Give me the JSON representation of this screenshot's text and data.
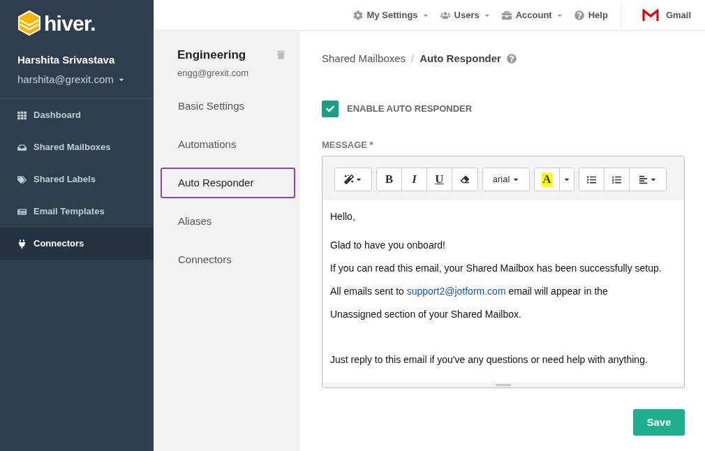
{
  "brand": {
    "name": "hiver."
  },
  "user": {
    "name": "Harshita Srivastava",
    "email": "harshita@grexit.com"
  },
  "nav": [
    {
      "label": "Dashboard",
      "selected": false
    },
    {
      "label": "Shared Mailboxes",
      "selected": false
    },
    {
      "label": "Shared Labels",
      "selected": false
    },
    {
      "label": "Email Templates",
      "selected": false
    },
    {
      "label": "Connectors",
      "selected": true
    }
  ],
  "topbar": [
    {
      "label": "My Settings",
      "dropdown": true
    },
    {
      "label": "Users",
      "dropdown": true
    },
    {
      "label": "Account",
      "dropdown": true
    },
    {
      "label": "Help",
      "dropdown": false
    }
  ],
  "gmail": {
    "label": "Gmail"
  },
  "mailbox": {
    "name": "Engineering",
    "email": "engg@grexit.com"
  },
  "settings_menu": [
    {
      "label": "Basic Settings",
      "selected": false
    },
    {
      "label": "Automations",
      "selected": false
    },
    {
      "label": "Auto Responder",
      "selected": true
    },
    {
      "label": "Aliases",
      "selected": false
    },
    {
      "label": "Connectors",
      "selected": false
    }
  ],
  "breadcrumb": {
    "parent": "Shared Mailboxes",
    "separator": "/",
    "current": "Auto Responder"
  },
  "enable": {
    "label": "ENABLE AUTO RESPONDER",
    "checked": true
  },
  "message": {
    "label": "MESSAGE *",
    "toolbar": [
      [
        {
          "kind": "magic"
        }
      ],
      [
        {
          "kind": "bold",
          "label": "B"
        },
        {
          "kind": "italic",
          "label": "I"
        },
        {
          "kind": "underline",
          "label": "U"
        },
        {
          "kind": "eraser"
        }
      ],
      [
        {
          "kind": "font",
          "label": "arial"
        }
      ],
      [
        {
          "kind": "highlight",
          "label": "A"
        },
        {
          "kind": "caret"
        }
      ],
      [
        {
          "kind": "bullets"
        },
        {
          "kind": "numbers"
        },
        {
          "kind": "align"
        }
      ]
    ],
    "lines": [
      {
        "text": "Hello,"
      },
      {
        "text": "Glad to have you onboard!"
      },
      {
        "text": "If you can read this email, your Shared Mailbox has been successfully setup."
      },
      {
        "text": "All emails sent to ",
        "link": "support2@jotform.com",
        "after": " email will appear in the"
      },
      {
        "text": "Unassigned section of your Shared Mailbox."
      },
      {
        "text": "Just reply to this email if you've any questions or need help with anything."
      }
    ]
  },
  "save": {
    "label": "Save"
  }
}
